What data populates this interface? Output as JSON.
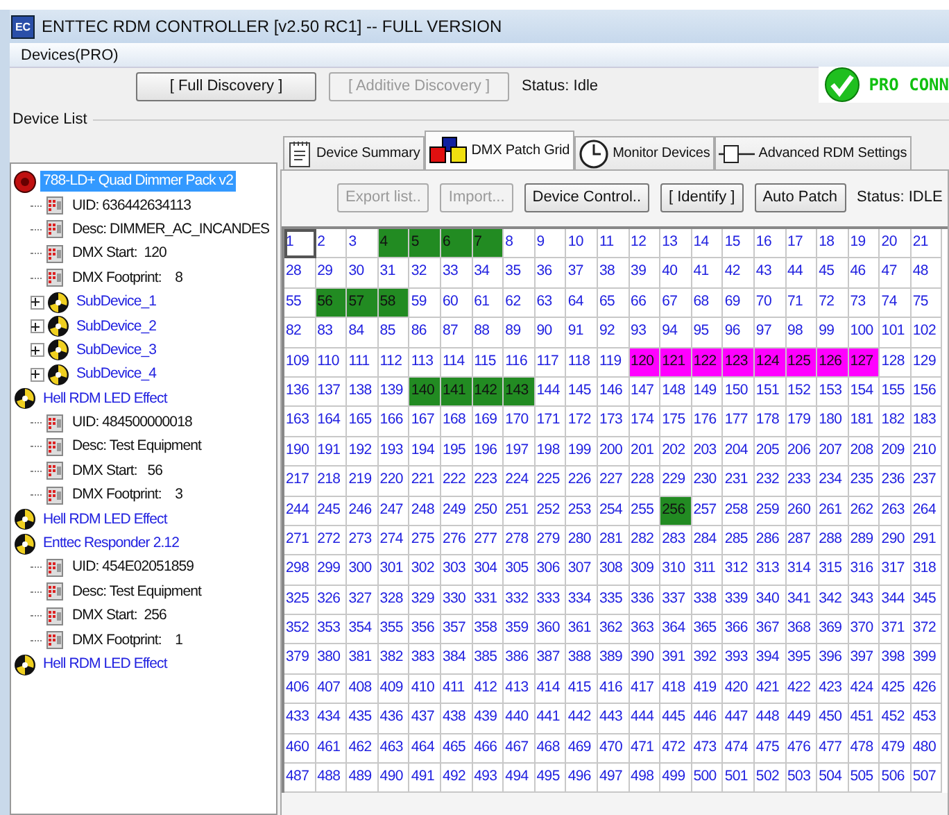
{
  "window": {
    "title": "ENTTEC RDM CONTROLLER [v2.50 RC1] -- FULL VERSION",
    "logo": "EC"
  },
  "menu": [
    "Devices(PRO)"
  ],
  "toolbar": {
    "buttons": [
      {
        "label": "[ Full Discovery ]",
        "disabled": false
      },
      {
        "label": "[ Additive Discovery ]",
        "disabled": true
      }
    ],
    "status": "Status: Idle",
    "connection": {
      "label": "PRO CONN",
      "connected": true
    }
  },
  "device_list": {
    "title": "Device List",
    "items": [
      {
        "kind": "dimmer",
        "label": "788-LD+ Quad Dimmer Pack v2",
        "selected": true,
        "children": [
          {
            "kind": "property",
            "label": "UID: 636442634113",
            "selected": false
          },
          {
            "kind": "property",
            "label": "Desc: DIMMER_AC_INCANDES",
            "selected": false
          },
          {
            "kind": "property",
            "label": "DMX Start:  120",
            "selected": false
          },
          {
            "kind": "property",
            "label": "DMX Footprint:    8",
            "selected": false
          },
          {
            "kind": "fixture",
            "label": "SubDevice_1",
            "selected": false,
            "expanded": false
          },
          {
            "kind": "fixture",
            "label": "SubDevice_2",
            "selected": false,
            "expanded": false
          },
          {
            "kind": "fixture",
            "label": "SubDevice_3",
            "selected": false,
            "expanded": false
          },
          {
            "kind": "fixture",
            "label": "SubDevice_4",
            "selected": false,
            "expanded": false
          }
        ]
      },
      {
        "kind": "fixture",
        "label": "Hell RDM LED Effect",
        "selected": false,
        "children": [
          {
            "kind": "property",
            "label": "UID: 484500000018",
            "selected": false
          },
          {
            "kind": "property",
            "label": "Desc: Test Equipment",
            "selected": false
          },
          {
            "kind": "property",
            "label": "DMX Start:   56",
            "selected": false
          },
          {
            "kind": "property",
            "label": "DMX Footprint:    3",
            "selected": false
          }
        ]
      },
      {
        "kind": "fixture",
        "label": "Hell RDM LED Effect",
        "selected": false
      },
      {
        "kind": "fixture",
        "label": "Enttec Responder 2.12",
        "selected": false,
        "children": [
          {
            "kind": "property",
            "label": "UID: 454E02051859",
            "selected": false
          },
          {
            "kind": "property",
            "label": "Desc: Test Equipment",
            "selected": false
          },
          {
            "kind": "property",
            "label": "DMX Start:  256",
            "selected": false
          },
          {
            "kind": "property",
            "label": "DMX Footprint:    1",
            "selected": false
          }
        ]
      },
      {
        "kind": "fixture",
        "label": "Hell RDM LED Effect",
        "selected": false
      }
    ]
  },
  "tabs": [
    {
      "label": "Device Summary",
      "kind": "notes",
      "selected": false
    },
    {
      "label": "DMX Patch Grid",
      "kind": "squares",
      "selected": true
    },
    {
      "label": "Monitor Devices",
      "kind": "clock",
      "selected": false
    },
    {
      "label": "Advanced RDM Settings",
      "kind": "slider",
      "selected": false
    }
  ],
  "patch_toolbar": {
    "buttons": [
      {
        "label": "Export list..",
        "disabled": true
      },
      {
        "label": "Import...",
        "disabled": true
      },
      {
        "label": "Device Control..",
        "disabled": false
      },
      {
        "label": "[ Identify ]",
        "disabled": false
      },
      {
        "label": "Auto Patch",
        "disabled": false
      }
    ],
    "status": "Status: IDLE"
  },
  "patch_grid": {
    "rows": [
      {
        "cells": [
          {
            "text": "1",
            "focused": true
          },
          {
            "text": "2"
          },
          {
            "text": "3"
          },
          {
            "text": "4",
            "color": "#228b22"
          },
          {
            "text": "5",
            "color": "#228b22"
          },
          {
            "text": "6",
            "color": "#228b22"
          },
          {
            "text": "7",
            "color": "#228b22"
          },
          {
            "text": "8"
          },
          {
            "text": "9"
          },
          {
            "text": "10"
          },
          {
            "text": "11"
          },
          {
            "text": "12"
          },
          {
            "text": "13"
          },
          {
            "text": "14"
          },
          {
            "text": "15"
          },
          {
            "text": "16"
          },
          {
            "text": "17"
          },
          {
            "text": "18"
          },
          {
            "text": "19"
          },
          {
            "text": "20"
          },
          {
            "text": "21"
          }
        ]
      },
      {
        "cells": [
          {
            "text": "28"
          },
          {
            "text": "29"
          },
          {
            "text": "30"
          },
          {
            "text": "31"
          },
          {
            "text": "32"
          },
          {
            "text": "33"
          },
          {
            "text": "34"
          },
          {
            "text": "35"
          },
          {
            "text": "36"
          },
          {
            "text": "37"
          },
          {
            "text": "38"
          },
          {
            "text": "39"
          },
          {
            "text": "40"
          },
          {
            "text": "41"
          },
          {
            "text": "42"
          },
          {
            "text": "43"
          },
          {
            "text": "44"
          },
          {
            "text": "45"
          },
          {
            "text": "46"
          },
          {
            "text": "47"
          },
          {
            "text": "48"
          }
        ]
      },
      {
        "cells": [
          {
            "text": "55"
          },
          {
            "text": "56",
            "color": "#228b22"
          },
          {
            "text": "57",
            "color": "#228b22"
          },
          {
            "text": "58",
            "color": "#228b22"
          },
          {
            "text": "59"
          },
          {
            "text": "60"
          },
          {
            "text": "61"
          },
          {
            "text": "62"
          },
          {
            "text": "63"
          },
          {
            "text": "64"
          },
          {
            "text": "65"
          },
          {
            "text": "66"
          },
          {
            "text": "67"
          },
          {
            "text": "68"
          },
          {
            "text": "69"
          },
          {
            "text": "70"
          },
          {
            "text": "71"
          },
          {
            "text": "72"
          },
          {
            "text": "73"
          },
          {
            "text": "74"
          },
          {
            "text": "75"
          }
        ]
      },
      {
        "cells": [
          {
            "text": "82"
          },
          {
            "text": "83"
          },
          {
            "text": "84"
          },
          {
            "text": "85"
          },
          {
            "text": "86"
          },
          {
            "text": "87"
          },
          {
            "text": "88"
          },
          {
            "text": "89"
          },
          {
            "text": "90"
          },
          {
            "text": "91"
          },
          {
            "text": "92"
          },
          {
            "text": "93"
          },
          {
            "text": "94"
          },
          {
            "text": "95"
          },
          {
            "text": "96"
          },
          {
            "text": "97"
          },
          {
            "text": "98"
          },
          {
            "text": "99"
          },
          {
            "text": "100"
          },
          {
            "text": "101"
          },
          {
            "text": "102"
          }
        ]
      },
      {
        "cells": [
          {
            "text": "109"
          },
          {
            "text": "110"
          },
          {
            "text": "111"
          },
          {
            "text": "112"
          },
          {
            "text": "113"
          },
          {
            "text": "114"
          },
          {
            "text": "115"
          },
          {
            "text": "116"
          },
          {
            "text": "117"
          },
          {
            "text": "118"
          },
          {
            "text": "119"
          },
          {
            "text": "120",
            "color": "#ff00ff"
          },
          {
            "text": "121",
            "color": "#ff00ff"
          },
          {
            "text": "122",
            "color": "#ff00ff"
          },
          {
            "text": "123",
            "color": "#ff00ff"
          },
          {
            "text": "124",
            "color": "#ff00ff"
          },
          {
            "text": "125",
            "color": "#ff00ff"
          },
          {
            "text": "126",
            "color": "#ff00ff"
          },
          {
            "text": "127",
            "color": "#ff00ff"
          },
          {
            "text": "128"
          },
          {
            "text": "129"
          }
        ]
      },
      {
        "cells": [
          {
            "text": "136"
          },
          {
            "text": "137"
          },
          {
            "text": "138"
          },
          {
            "text": "139"
          },
          {
            "text": "140",
            "color": "#228b22"
          },
          {
            "text": "141",
            "color": "#228b22"
          },
          {
            "text": "142",
            "color": "#228b22"
          },
          {
            "text": "143",
            "color": "#228b22"
          },
          {
            "text": "144"
          },
          {
            "text": "145"
          },
          {
            "text": "146"
          },
          {
            "text": "147"
          },
          {
            "text": "148"
          },
          {
            "text": "149"
          },
          {
            "text": "150"
          },
          {
            "text": "151"
          },
          {
            "text": "152"
          },
          {
            "text": "153"
          },
          {
            "text": "154"
          },
          {
            "text": "155"
          },
          {
            "text": "156"
          }
        ]
      },
      {
        "cells": [
          {
            "text": "163"
          },
          {
            "text": "164"
          },
          {
            "text": "165"
          },
          {
            "text": "166"
          },
          {
            "text": "167"
          },
          {
            "text": "168"
          },
          {
            "text": "169"
          },
          {
            "text": "170"
          },
          {
            "text": "171"
          },
          {
            "text": "172"
          },
          {
            "text": "173"
          },
          {
            "text": "174"
          },
          {
            "text": "175"
          },
          {
            "text": "176"
          },
          {
            "text": "177"
          },
          {
            "text": "178"
          },
          {
            "text": "179"
          },
          {
            "text": "180"
          },
          {
            "text": "181"
          },
          {
            "text": "182"
          },
          {
            "text": "183"
          }
        ]
      },
      {
        "cells": [
          {
            "text": "190"
          },
          {
            "text": "191"
          },
          {
            "text": "192"
          },
          {
            "text": "193"
          },
          {
            "text": "194"
          },
          {
            "text": "195"
          },
          {
            "text": "196"
          },
          {
            "text": "197"
          },
          {
            "text": "198"
          },
          {
            "text": "199"
          },
          {
            "text": "200"
          },
          {
            "text": "201"
          },
          {
            "text": "202"
          },
          {
            "text": "203"
          },
          {
            "text": "204"
          },
          {
            "text": "205"
          },
          {
            "text": "206"
          },
          {
            "text": "207"
          },
          {
            "text": "208"
          },
          {
            "text": "209"
          },
          {
            "text": "210"
          }
        ]
      },
      {
        "cells": [
          {
            "text": "217"
          },
          {
            "text": "218"
          },
          {
            "text": "219"
          },
          {
            "text": "220"
          },
          {
            "text": "221"
          },
          {
            "text": "222"
          },
          {
            "text": "223"
          },
          {
            "text": "224"
          },
          {
            "text": "225"
          },
          {
            "text": "226"
          },
          {
            "text": "227"
          },
          {
            "text": "228"
          },
          {
            "text": "229"
          },
          {
            "text": "230"
          },
          {
            "text": "231"
          },
          {
            "text": "232"
          },
          {
            "text": "233"
          },
          {
            "text": "234"
          },
          {
            "text": "235"
          },
          {
            "text": "236"
          },
          {
            "text": "237"
          }
        ]
      },
      {
        "cells": [
          {
            "text": "244"
          },
          {
            "text": "245"
          },
          {
            "text": "246"
          },
          {
            "text": "247"
          },
          {
            "text": "248"
          },
          {
            "text": "249"
          },
          {
            "text": "250"
          },
          {
            "text": "251"
          },
          {
            "text": "252"
          },
          {
            "text": "253"
          },
          {
            "text": "254"
          },
          {
            "text": "255"
          },
          {
            "text": "256",
            "color": "#228b22"
          },
          {
            "text": "257"
          },
          {
            "text": "258"
          },
          {
            "text": "259"
          },
          {
            "text": "260"
          },
          {
            "text": "261"
          },
          {
            "text": "262"
          },
          {
            "text": "263"
          },
          {
            "text": "264"
          }
        ]
      },
      {
        "cells": [
          {
            "text": "271"
          },
          {
            "text": "272"
          },
          {
            "text": "273"
          },
          {
            "text": "274"
          },
          {
            "text": "275"
          },
          {
            "text": "276"
          },
          {
            "text": "277"
          },
          {
            "text": "278"
          },
          {
            "text": "279"
          },
          {
            "text": "280"
          },
          {
            "text": "281"
          },
          {
            "text": "282"
          },
          {
            "text": "283"
          },
          {
            "text": "284"
          },
          {
            "text": "285"
          },
          {
            "text": "286"
          },
          {
            "text": "287"
          },
          {
            "text": "288"
          },
          {
            "text": "289"
          },
          {
            "text": "290"
          },
          {
            "text": "291"
          }
        ]
      },
      {
        "cells": [
          {
            "text": "298"
          },
          {
            "text": "299"
          },
          {
            "text": "300"
          },
          {
            "text": "301"
          },
          {
            "text": "302"
          },
          {
            "text": "303"
          },
          {
            "text": "304"
          },
          {
            "text": "305"
          },
          {
            "text": "306"
          },
          {
            "text": "307"
          },
          {
            "text": "308"
          },
          {
            "text": "309"
          },
          {
            "text": "310"
          },
          {
            "text": "311"
          },
          {
            "text": "312"
          },
          {
            "text": "313"
          },
          {
            "text": "314"
          },
          {
            "text": "315"
          },
          {
            "text": "316"
          },
          {
            "text": "317"
          },
          {
            "text": "318"
          }
        ]
      },
      {
        "cells": [
          {
            "text": "325"
          },
          {
            "text": "326"
          },
          {
            "text": "327"
          },
          {
            "text": "328"
          },
          {
            "text": "329"
          },
          {
            "text": "330"
          },
          {
            "text": "331"
          },
          {
            "text": "332"
          },
          {
            "text": "333"
          },
          {
            "text": "334"
          },
          {
            "text": "335"
          },
          {
            "text": "336"
          },
          {
            "text": "337"
          },
          {
            "text": "338"
          },
          {
            "text": "339"
          },
          {
            "text": "340"
          },
          {
            "text": "341"
          },
          {
            "text": "342"
          },
          {
            "text": "343"
          },
          {
            "text": "344"
          },
          {
            "text": "345"
          }
        ]
      },
      {
        "cells": [
          {
            "text": "352"
          },
          {
            "text": "353"
          },
          {
            "text": "354"
          },
          {
            "text": "355"
          },
          {
            "text": "356"
          },
          {
            "text": "357"
          },
          {
            "text": "358"
          },
          {
            "text": "359"
          },
          {
            "text": "360"
          },
          {
            "text": "361"
          },
          {
            "text": "362"
          },
          {
            "text": "363"
          },
          {
            "text": "364"
          },
          {
            "text": "365"
          },
          {
            "text": "366"
          },
          {
            "text": "367"
          },
          {
            "text": "368"
          },
          {
            "text": "369"
          },
          {
            "text": "370"
          },
          {
            "text": "371"
          },
          {
            "text": "372"
          }
        ]
      },
      {
        "cells": [
          {
            "text": "379"
          },
          {
            "text": "380"
          },
          {
            "text": "381"
          },
          {
            "text": "382"
          },
          {
            "text": "383"
          },
          {
            "text": "384"
          },
          {
            "text": "385"
          },
          {
            "text": "386"
          },
          {
            "text": "387"
          },
          {
            "text": "388"
          },
          {
            "text": "389"
          },
          {
            "text": "390"
          },
          {
            "text": "391"
          },
          {
            "text": "392"
          },
          {
            "text": "393"
          },
          {
            "text": "394"
          },
          {
            "text": "395"
          },
          {
            "text": "396"
          },
          {
            "text": "397"
          },
          {
            "text": "398"
          },
          {
            "text": "399"
          }
        ]
      },
      {
        "cells": [
          {
            "text": "406"
          },
          {
            "text": "407"
          },
          {
            "text": "408"
          },
          {
            "text": "409"
          },
          {
            "text": "410"
          },
          {
            "text": "411"
          },
          {
            "text": "412"
          },
          {
            "text": "413"
          },
          {
            "text": "414"
          },
          {
            "text": "415"
          },
          {
            "text": "416"
          },
          {
            "text": "417"
          },
          {
            "text": "418"
          },
          {
            "text": "419"
          },
          {
            "text": "420"
          },
          {
            "text": "421"
          },
          {
            "text": "422"
          },
          {
            "text": "423"
          },
          {
            "text": "424"
          },
          {
            "text": "425"
          },
          {
            "text": "426"
          }
        ]
      },
      {
        "cells": [
          {
            "text": "433"
          },
          {
            "text": "434"
          },
          {
            "text": "435"
          },
          {
            "text": "436"
          },
          {
            "text": "437"
          },
          {
            "text": "438"
          },
          {
            "text": "439"
          },
          {
            "text": "440"
          },
          {
            "text": "441"
          },
          {
            "text": "442"
          },
          {
            "text": "443"
          },
          {
            "text": "444"
          },
          {
            "text": "445"
          },
          {
            "text": "446"
          },
          {
            "text": "447"
          },
          {
            "text": "448"
          },
          {
            "text": "449"
          },
          {
            "text": "450"
          },
          {
            "text": "451"
          },
          {
            "text": "452"
          },
          {
            "text": "453"
          }
        ]
      },
      {
        "cells": [
          {
            "text": "460"
          },
          {
            "text": "461"
          },
          {
            "text": "462"
          },
          {
            "text": "463"
          },
          {
            "text": "464"
          },
          {
            "text": "465"
          },
          {
            "text": "466"
          },
          {
            "text": "467"
          },
          {
            "text": "468"
          },
          {
            "text": "469"
          },
          {
            "text": "470"
          },
          {
            "text": "471"
          },
          {
            "text": "472"
          },
          {
            "text": "473"
          },
          {
            "text": "474"
          },
          {
            "text": "475"
          },
          {
            "text": "476"
          },
          {
            "text": "477"
          },
          {
            "text": "478"
          },
          {
            "text": "479"
          },
          {
            "text": "480"
          }
        ]
      },
      {
        "cells": [
          {
            "text": "487"
          },
          {
            "text": "488"
          },
          {
            "text": "489"
          },
          {
            "text": "490"
          },
          {
            "text": "491"
          },
          {
            "text": "492"
          },
          {
            "text": "493"
          },
          {
            "text": "494"
          },
          {
            "text": "495"
          },
          {
            "text": "496"
          },
          {
            "text": "497"
          },
          {
            "text": "498"
          },
          {
            "text": "499"
          },
          {
            "text": "500"
          },
          {
            "text": "501"
          },
          {
            "text": "502"
          },
          {
            "text": "503"
          },
          {
            "text": "504"
          },
          {
            "text": "505"
          },
          {
            "text": "506"
          },
          {
            "text": "507"
          }
        ]
      }
    ]
  }
}
